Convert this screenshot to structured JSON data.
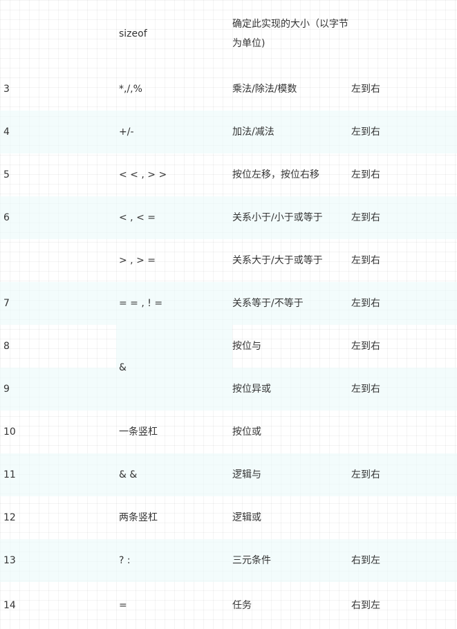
{
  "table": {
    "rows": [
      {
        "prec": "",
        "op": "sizeof",
        "desc": "确定此实现的大小（以字节为单位)",
        "assoc": ""
      },
      {
        "prec": "3",
        "op": "*,/,%",
        "desc": "乘法/除法/模数",
        "assoc": "左到右"
      },
      {
        "prec": "4",
        "op": "+/-",
        "desc": "加法/减法",
        "assoc": "左到右"
      },
      {
        "prec": "5",
        "op": "< < , > >",
        "desc": "按位左移，按位右移",
        "assoc": "左到右"
      },
      {
        "prec": "6",
        "op": "< , < =",
        "desc": "关系小于/小于或等于",
        "assoc": "左到右"
      },
      {
        "prec": "",
        "op": "> , > =",
        "desc": "关系大于/大于或等于",
        "assoc": "左到右"
      },
      {
        "prec": "7",
        "op": "= = , ! =",
        "desc": "关系等于/不等于",
        "assoc": "左到右"
      },
      {
        "prec": "8",
        "op": "&",
        "desc": "按位与",
        "assoc": "左到右"
      },
      {
        "prec": "9",
        "op": "",
        "desc": "按位异或",
        "assoc": "左到右"
      },
      {
        "prec": "10",
        "op": "一条竖杠",
        "desc": "按位或",
        "assoc": ""
      },
      {
        "prec": "11",
        "op": "& &",
        "desc": "逻辑与",
        "assoc": "左到右"
      },
      {
        "prec": "12",
        "op": "两条竖杠",
        "desc": "逻辑或",
        "assoc": ""
      },
      {
        "prec": "13",
        "op": "? :",
        "desc": "三元条件",
        "assoc": "右到左"
      },
      {
        "prec": "14",
        "op": "=",
        "desc": "任务",
        "assoc": "右到左"
      }
    ]
  }
}
